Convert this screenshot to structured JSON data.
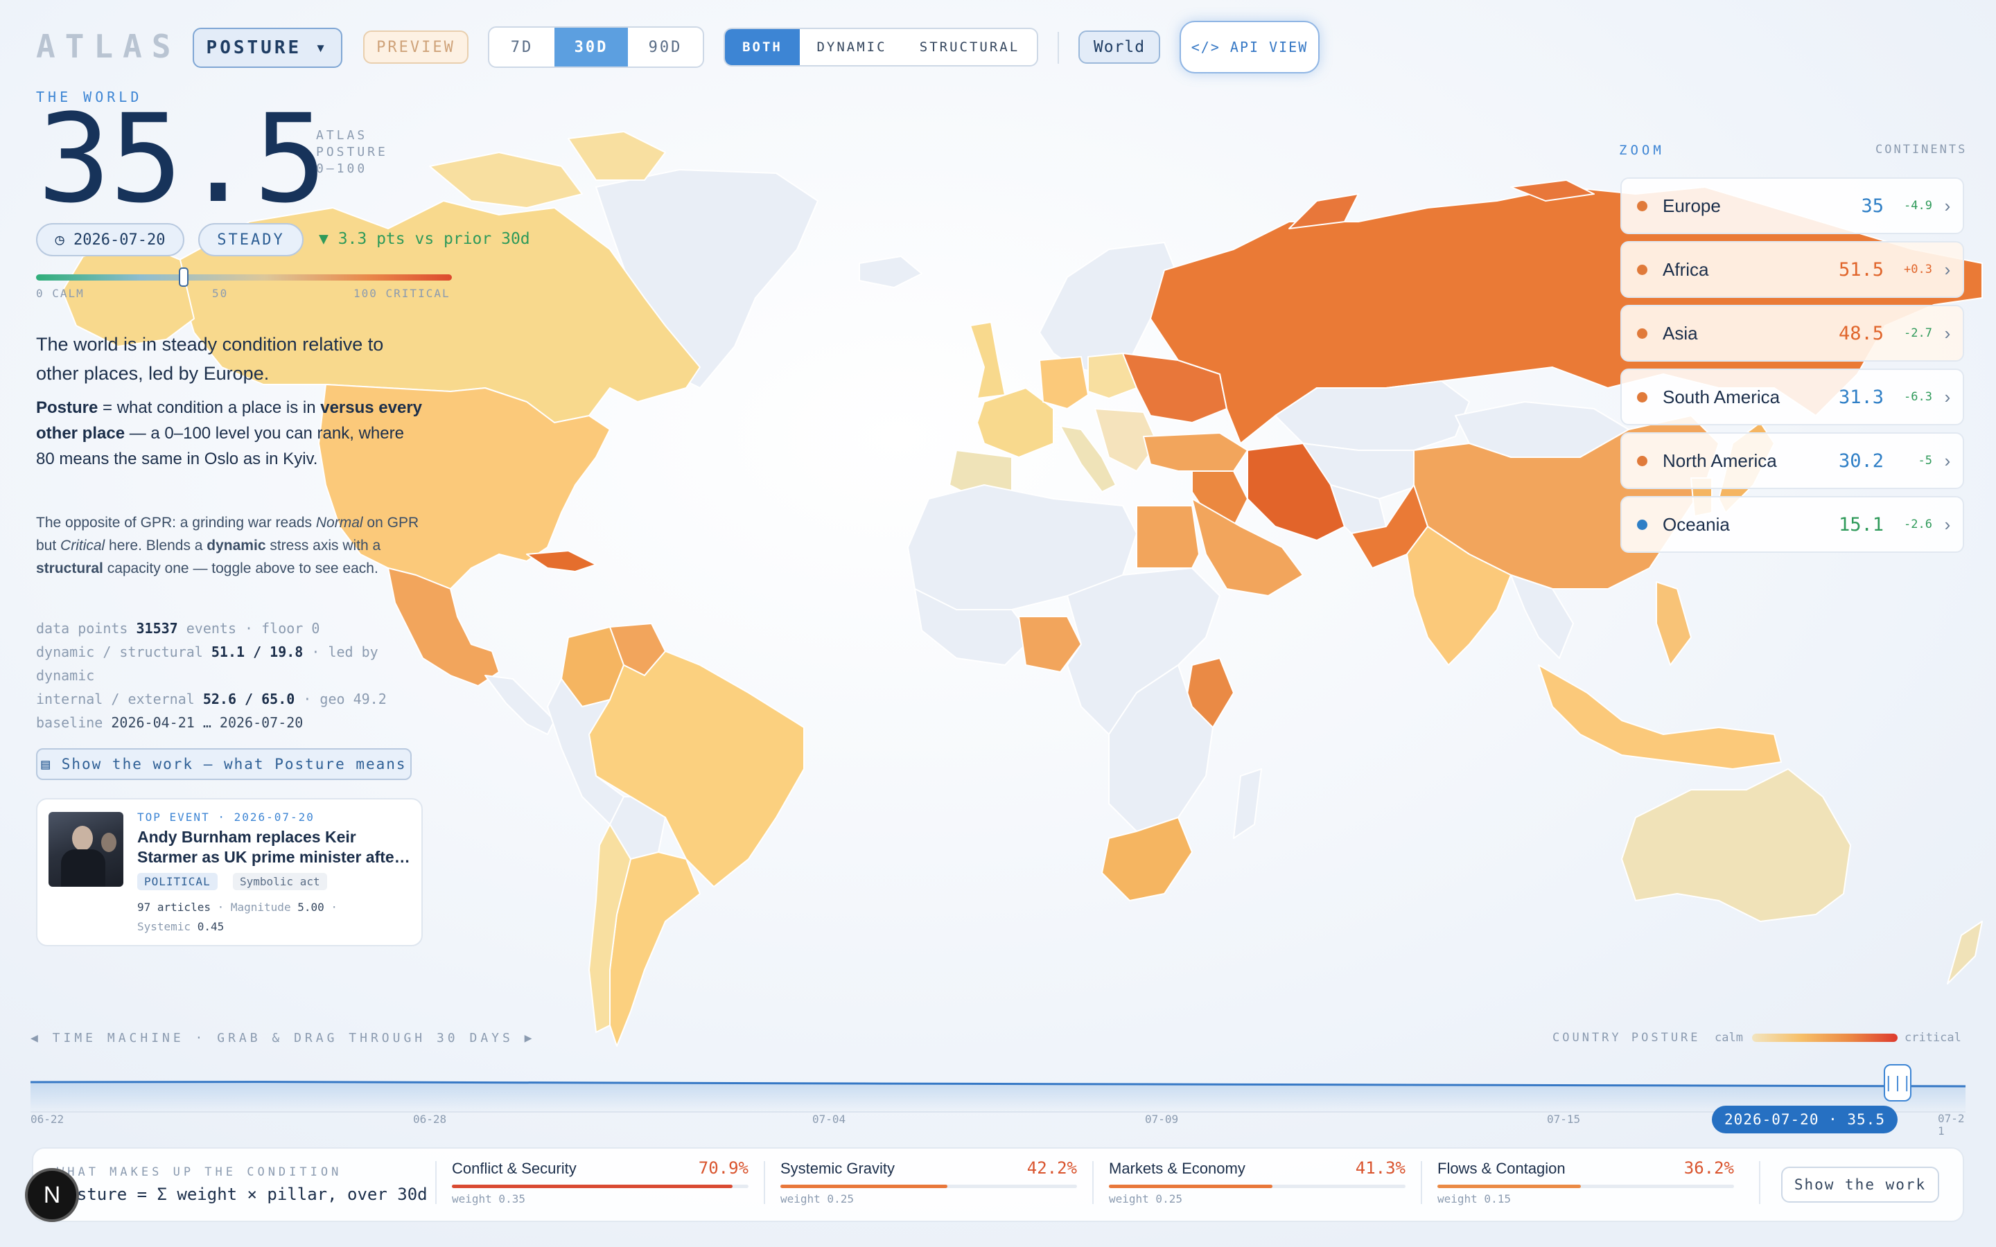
{
  "app": {
    "logo": "ATLAS"
  },
  "toolbar": {
    "metric_select": "POSTURE ▾",
    "preview_badge": "PREVIEW",
    "range_tabs": [
      "7D",
      "30D",
      "90D"
    ],
    "range_active": "30D",
    "mode_tabs": [
      "BOTH",
      "DYNAMIC",
      "STRUCTURAL"
    ],
    "mode_active": "BOTH",
    "region_button": "World",
    "api_button": "</> API VIEW"
  },
  "score": {
    "scope_label": "THE WORLD",
    "value": "35.5",
    "caption_lines": [
      "ATLAS",
      "POSTURE",
      "0–100"
    ],
    "date_pill": "◷ 2026-07-20",
    "status_pill": "STEADY",
    "delta_text": "▼ 3.3 pts vs prior 30d",
    "scale_calm": "0 CALM",
    "scale_mid": "50",
    "scale_critical": "100 CRITICAL",
    "scale_level_pct": 35.5
  },
  "description": {
    "headline": "The world is in steady condition relative to other places, led by Europe.",
    "definition_parts": [
      {
        "t": "Posture",
        "b": true
      },
      {
        "t": " = what condition a place is in ",
        "b": false
      },
      {
        "t": "versus every other place",
        "b": true
      },
      {
        "t": " — a 0–100 level you can rank, where 80 means the same in Oslo as in Kyiv.",
        "b": false
      }
    ],
    "explainer_parts": [
      {
        "t": "The opposite of GPR: a grinding war reads ",
        "s": ""
      },
      {
        "t": "Normal",
        "s": "i"
      },
      {
        "t": " on GPR but ",
        "s": ""
      },
      {
        "t": "Critical",
        "s": "i"
      },
      {
        "t": " here. Blends a ",
        "s": ""
      },
      {
        "t": "dynamic",
        "s": "b"
      },
      {
        "t": " stress axis with a ",
        "s": ""
      },
      {
        "t": "structural",
        "s": "b"
      },
      {
        "t": " capacity one — toggle above to see each.",
        "s": ""
      }
    ]
  },
  "stats": {
    "l1_label": "data points",
    "l1_value": "31537",
    "l1_tail": "events · floor 0",
    "l2_label": "dynamic / structural",
    "l2_value": "51.1 / 19.8",
    "l2_tail": "· led by dynamic",
    "l3_label": "internal / external",
    "l3_value": "52.6 / 65.0",
    "l3_tail": "· geo 49.2",
    "l4_label": "baseline",
    "l4_value": "2026-04-21 … 2026-07-20"
  },
  "show_work_button": "▤ Show the work — what Posture means",
  "top_event": {
    "kicker": "TOP EVENT · 2026-07-20",
    "title": "Andy Burnham replaces Keir Starmer as UK prime minister afte…",
    "tag1": "POLITICAL",
    "tag2": "Symbolic act",
    "meta1": "97 articles",
    "meta2": "· Magnitude",
    "meta2_val": "5.00",
    "meta3": "·",
    "meta4": "Systemic",
    "meta4_val": "0.45"
  },
  "continents": {
    "zoom_label": "ZOOM",
    "scope_label": "CONTINENTS",
    "items": [
      {
        "name": "Europe",
        "score": "35",
        "delta": "-4.9",
        "color": "#e07a3a",
        "valcolor": "#2f7fc6",
        "highlight": false
      },
      {
        "name": "Africa",
        "score": "51.5",
        "delta": "+0.3",
        "color": "#e07a3a",
        "valcolor": "#e0652b",
        "highlight": true
      },
      {
        "name": "Asia",
        "score": "48.5",
        "delta": "-2.7",
        "color": "#e07a3a",
        "valcolor": "#e0652b",
        "highlight": true
      },
      {
        "name": "South America",
        "score": "31.3",
        "delta": "-6.3",
        "color": "#e07a3a",
        "valcolor": "#2f7fc6",
        "highlight": false
      },
      {
        "name": "North America",
        "score": "30.2",
        "delta": "-5",
        "color": "#e07a3a",
        "valcolor": "#2f7fc6",
        "highlight": false
      },
      {
        "name": "Oceania",
        "score": "15.1",
        "delta": "-2.6",
        "color": "#2f7fc6",
        "valcolor": "#2f9a5a",
        "highlight": false
      }
    ]
  },
  "timeline": {
    "title": "◀ TIME MACHINE · GRAB & DRAG THROUGH 30 DAYS ▶",
    "legend_label": "COUNTRY POSTURE",
    "legend_calm": "calm",
    "legend_critical": "critical",
    "ticks": [
      "06-22",
      "06-28",
      "07-04",
      "07-09",
      "07-15",
      "07-21"
    ],
    "current_badge": "2026-07-20 · 35.5"
  },
  "breakdown": {
    "heading": "WHAT MAKES UP THE CONDITION",
    "formula": "Posture = Σ weight × pillar, over 30d",
    "pillars": [
      {
        "name": "Conflict & Security",
        "pct": "70.9%",
        "weight": "weight 0.35",
        "level": 0.709,
        "color": "#d94a32"
      },
      {
        "name": "Systemic Gravity",
        "pct": "42.2%",
        "weight": "weight 0.25",
        "level": 0.422,
        "color": "#e8773a"
      },
      {
        "name": "Markets & Economy",
        "pct": "41.3%",
        "weight": "weight 0.25",
        "level": 0.413,
        "color": "#e8773a"
      },
      {
        "name": "Flows & Contagion",
        "pct": "36.2%",
        "weight": "weight 0.15",
        "level": 0.362,
        "color": "#ea8a45"
      }
    ],
    "show_work_button": "Show the work"
  },
  "avatar_letter": "N"
}
